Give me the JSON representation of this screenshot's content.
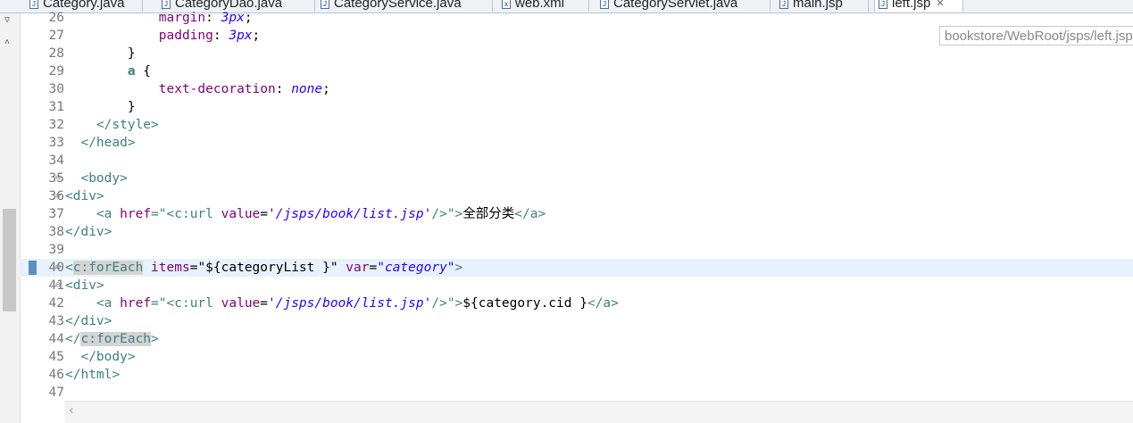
{
  "tabs": [
    {
      "label": "Category.java",
      "icon": "J"
    },
    {
      "label": "CategoryDao.java",
      "icon": "J"
    },
    {
      "label": "CategoryService.java",
      "icon": "J"
    },
    {
      "label": "web.xml",
      "icon": "x"
    },
    {
      "label": "CategoryServlet.java",
      "icon": "J"
    },
    {
      "label": "main.jsp",
      "icon": "J"
    },
    {
      "label": "left.jsp",
      "icon": "J",
      "active": true
    }
  ],
  "tab_close": "✕",
  "path_hint": "bookstore/WebRoot/jsps/left.jsp",
  "lines": [
    {
      "n": "26"
    },
    {
      "n": "27"
    },
    {
      "n": "28"
    },
    {
      "n": "29"
    },
    {
      "n": "30"
    },
    {
      "n": "31"
    },
    {
      "n": "32"
    },
    {
      "n": "33"
    },
    {
      "n": "34"
    },
    {
      "n": "35"
    },
    {
      "n": "36"
    },
    {
      "n": "37"
    },
    {
      "n": "38"
    },
    {
      "n": "39"
    },
    {
      "n": "40"
    },
    {
      "n": "41"
    },
    {
      "n": "42"
    },
    {
      "n": "43"
    },
    {
      "n": "44"
    },
    {
      "n": "45"
    },
    {
      "n": "46"
    },
    {
      "n": "47"
    }
  ],
  "code": {
    "l26": {
      "prop": "margin",
      "val": "3px"
    },
    "l27": {
      "prop": "padding",
      "val": "3px"
    },
    "l28": {
      "text": "}"
    },
    "l29": {
      "sel": "a",
      "text": " {"
    },
    "l30": {
      "prop": "text-decoration",
      "val": "none"
    },
    "l31": {
      "text": "}"
    },
    "l32": {
      "tag": "</style>"
    },
    "l33": {
      "tag": "</head>"
    },
    "l35": {
      "tag": "<body>"
    },
    "l36": {
      "tag": "<div>"
    },
    "l37": {
      "open": "<a ",
      "attr": "href",
      "q1": "=\"",
      "tagopen": "<c:url ",
      "attr2": "value",
      "eq": "=",
      "val": "'/jsps/book/list.jsp'",
      "tagclose": "/>",
      "q2": "\"",
      "gt": ">",
      "text": "全部分类",
      "close": "</a>"
    },
    "l38": {
      "tag": "</div>"
    },
    "l40": {
      "lt": "<",
      "name": "c:forEach",
      "attr": " items",
      "eq": "=",
      "val": "\"${categoryList }\"",
      "attr2": " var",
      "eq2": "=",
      "val2": "\"category\"",
      "gt": ">"
    },
    "l41": {
      "tag": "<div>"
    },
    "l42": {
      "open": "<a ",
      "attr": "href",
      "q1": "=\"",
      "tagopen": "<c:url ",
      "attr2": "value",
      "eq": "=",
      "val": "'/jsps/book/list.jsp'",
      "tagclose": "/>",
      "q2": "\"",
      "gt": ">",
      "text": "${category.cid }",
      "close": "</a>"
    },
    "l43": {
      "tag": "</div>"
    },
    "l44": {
      "lt": "</",
      "name": "c:forEach",
      "gt": ">"
    },
    "l45": {
      "tag": "</body>"
    },
    "l46": {
      "tag": "</html>"
    }
  }
}
